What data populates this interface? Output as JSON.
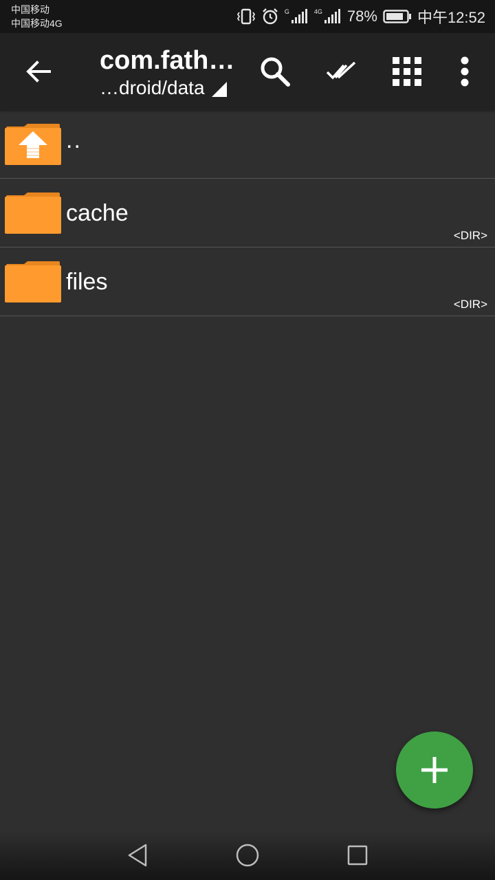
{
  "status_bar": {
    "carrier_1": "中国移动",
    "carrier_2": "中国移动4G",
    "signal_1_label": "G",
    "signal_2_label": "4G",
    "battery_percent": "78%",
    "time": "中午12:52",
    "icons": [
      "vibrate-icon",
      "alarm-icon",
      "signal-icon",
      "signal-icon",
      "battery-icon"
    ]
  },
  "app_bar": {
    "title": "com.fath…",
    "subtitle": "…droid/data",
    "actions": [
      "search-icon",
      "select-all-icon",
      "grid-view-icon",
      "more-vert-icon"
    ]
  },
  "files": [
    {
      "name": "..",
      "type": "",
      "icon": "folder-up-icon"
    },
    {
      "name": "cache",
      "type": "<DIR>",
      "icon": "folder-icon"
    },
    {
      "name": "files",
      "type": "<DIR>",
      "icon": "folder-icon"
    }
  ],
  "fab": {
    "icon": "plus-icon"
  },
  "colors": {
    "background": "#2f2f2f",
    "app_bar": "#222222",
    "status_bar": "#161616",
    "folder": "#ff9a2e",
    "fab": "#3fa144",
    "divider": "#555555"
  }
}
